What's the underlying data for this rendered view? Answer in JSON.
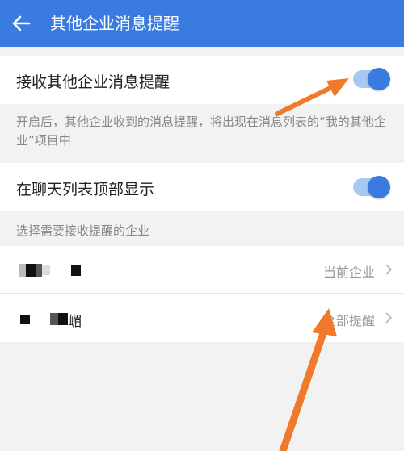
{
  "header": {
    "title": "其他企业消息提醒",
    "back_icon": "back-arrow-icon"
  },
  "colors": {
    "header_bg": "#3a7be0",
    "toggle_on": "#3a7be0",
    "annotation_arrow": "#f07a2c"
  },
  "settings": {
    "receive_label": "接收其他企业消息提醒",
    "receive_on": true,
    "receive_desc": "开启后，其他企业收到的消息提醒，将出现在消息列表的“我的其他企业”项目中",
    "top_label": "在聊天列表顶部显示",
    "top_on": true
  },
  "companies": {
    "section_label": "选择需要接收提醒的企业",
    "items": [
      {
        "name_partial": "",
        "status": "当前企业"
      },
      {
        "name_partial": "嵋",
        "status": "全部提醒"
      }
    ]
  }
}
